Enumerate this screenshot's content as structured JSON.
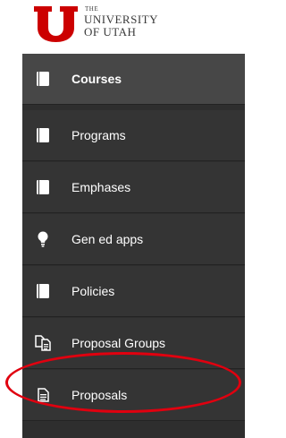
{
  "brand": {
    "the": "THE",
    "line1": "UNIVERSITY",
    "line2": "OF UTAH",
    "color": "#cc0000"
  },
  "nav": {
    "items": [
      {
        "label": "Courses",
        "icon": "book-icon",
        "active": true
      },
      {
        "label": "Programs",
        "icon": "book-icon",
        "active": false
      },
      {
        "label": "Emphases",
        "icon": "book-icon",
        "active": false
      },
      {
        "label": "Gen ed apps",
        "icon": "lightbulb-icon",
        "active": false
      },
      {
        "label": "Policies",
        "icon": "book-icon",
        "active": false
      },
      {
        "label": "Proposal Groups",
        "icon": "documents-icon",
        "active": false
      },
      {
        "label": "Proposals",
        "icon": "document-icon",
        "active": false
      }
    ]
  },
  "annotation": {
    "color": "#e0000f",
    "target": "Proposals"
  }
}
